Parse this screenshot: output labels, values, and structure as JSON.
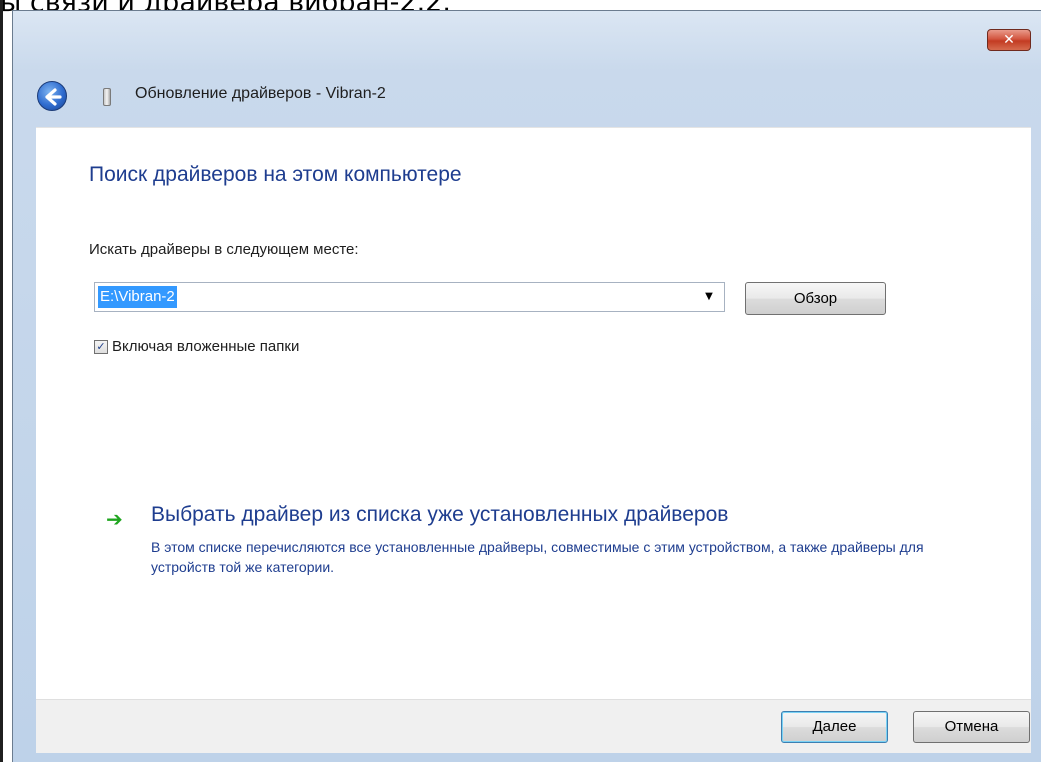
{
  "document": {
    "heading": "ы связи и драйвера вибран-2.2."
  },
  "window": {
    "title": "Обновление драйверов - Vibran-2",
    "close_glyph": "✕",
    "back_icon": "back-arrow-icon",
    "device_icon": "device-icon"
  },
  "main": {
    "page_title": "Поиск драйверов на этом компьютере",
    "location_label": "Искать драйверы в следующем месте:",
    "path_value": "E:\\Vibran-2",
    "combo_arrow": "▼",
    "browse_label": "Обзор",
    "include_subfolders": {
      "label": "Включая вложенные папки",
      "checked": true,
      "check_glyph": "✓"
    },
    "choose_link": {
      "arrow_glyph": "➔",
      "title": "Выбрать драйвер из списка уже установленных драйверов",
      "description": "В этом списке перечисляются все установленные драйверы, совместимые с этим устройством, а также драйверы для устройств той же категории."
    }
  },
  "footer": {
    "next_label": "Далее",
    "cancel_label": "Отмена"
  },
  "colors": {
    "accent": "#1e3d8f",
    "selection": "#3399ff",
    "link_arrow": "#1fa51f",
    "close_button": "#c33b22"
  }
}
